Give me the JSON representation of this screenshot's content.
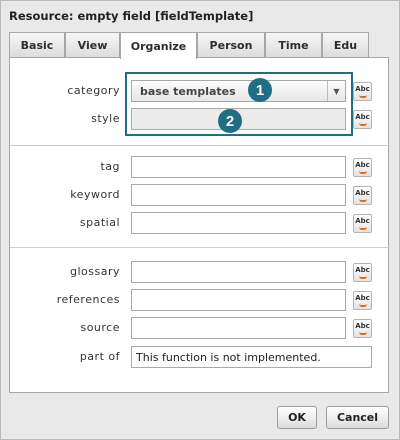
{
  "window": {
    "title": "Resource: empty field [fieldTemplate]"
  },
  "tabs": [
    {
      "label": "Basic",
      "active": false
    },
    {
      "label": "View",
      "active": false
    },
    {
      "label": "Organize",
      "active": true
    },
    {
      "label": "Person",
      "active": false
    },
    {
      "label": "Time",
      "active": false
    },
    {
      "label": "Edu",
      "active": false
    }
  ],
  "fields": {
    "category": {
      "label": "category",
      "value": "base templates"
    },
    "style": {
      "label": "style",
      "value": ""
    },
    "tag": {
      "label": "tag",
      "value": ""
    },
    "keyword": {
      "label": "keyword",
      "value": ""
    },
    "spatial": {
      "label": "spatial",
      "value": ""
    },
    "glossary": {
      "label": "glossary",
      "value": ""
    },
    "references": {
      "label": "references",
      "value": ""
    },
    "source": {
      "label": "source",
      "value": ""
    },
    "part_of": {
      "label": "part of",
      "value": "This function is not implemented."
    }
  },
  "spellcheck_icon": {
    "text": "Abc",
    "icon": "spellcheck-icon"
  },
  "markers": [
    "1",
    "2"
  ],
  "buttons": {
    "ok": "OK",
    "cancel": "Cancel"
  },
  "colors": {
    "highlight": "#1f6e83",
    "accent": "#e06a10"
  }
}
